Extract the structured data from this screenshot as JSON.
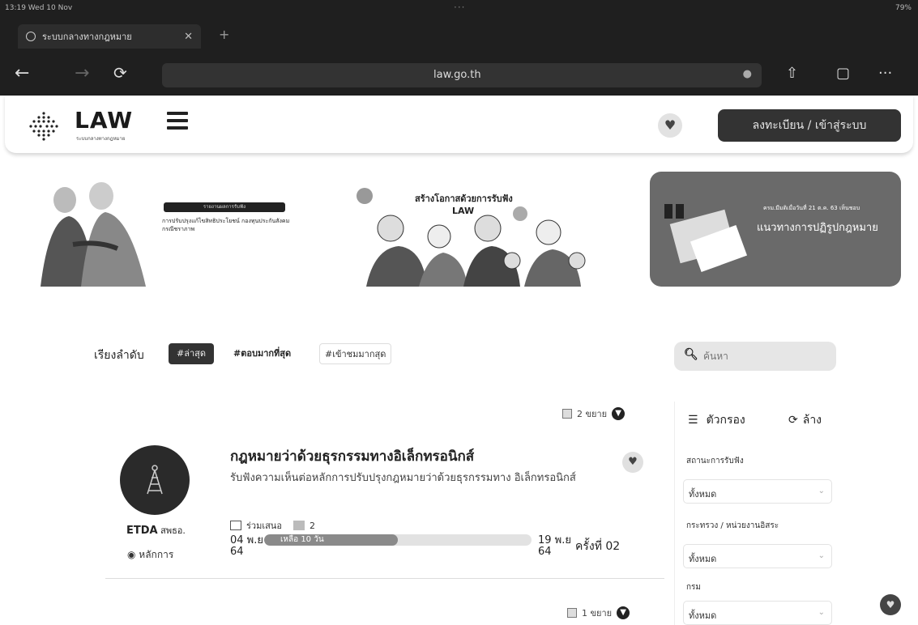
{
  "browser": {
    "status_time": "13:19  Wed 10 Nov",
    "battery": "79%",
    "tab_title": "ระบบกลางทางกฎหมาย",
    "url": "law.go.th"
  },
  "header": {
    "logo_text": "LAW",
    "logo_subtitle": "ระบบกลางทางกฎหมาย",
    "login_label": "ลงทะเบียน / เข้าสู่ระบบ"
  },
  "banners": [
    {
      "pill": "รายงานผลการรับฟัง",
      "lines": "การปรับปรุงแก้ไขสิทธิประโยชน์ กองทุนประกันสังคมกรณีชราภาพ"
    },
    {
      "title": "สร้างโอกาสด้วยการรับฟัง",
      "logo": "LAW"
    },
    {
      "line1": "ครม.มีมติเมื่อวันที่ 21 ต.ค. 63 เห็นชอบ",
      "line2": "แนวทางการปฏิรูปกฎหมาย"
    }
  ],
  "sort": {
    "label": "เรียงลำดับ",
    "options": [
      "#ล่าสุด",
      "#ตอบมากที่สุด",
      "#เข้าชมมากสุด"
    ]
  },
  "search": {
    "placeholder": "ค้นหา"
  },
  "expand_top": "2 ขยาย",
  "expand_bottom": "1 ขยาย",
  "card": {
    "title": "กฎหมายว่าด้วยธุรกรรมทางอิเล็กทรอนิกส์",
    "description": "รับฟังความเห็นต่อหลักการปรับปรุงกฎหมายว่าด้วยธุรกรรมทาง อิเล็กทรอนิกส์",
    "org": "ETDA",
    "org_short": "สพธอ.",
    "category": "หลักการ",
    "participants_label": "ร่วมเสนอ",
    "comment_count": "2",
    "start_day": "04 พ.ย",
    "start_year": "64",
    "end_day": "19 พ.ย",
    "end_year": "64",
    "remaining": "เหลือ 10 วัน",
    "progress": 0.5,
    "round": "ครั้งที่ 02"
  },
  "filters": {
    "title": "ตัวกรอง",
    "reset": "ล้าง",
    "groups": [
      {
        "label": "สถานะการรับฟัง",
        "value": "ทั้งหมด"
      },
      {
        "label": "กระทรวง / หน่วยงานอิสระ",
        "value": "ทั้งหมด"
      },
      {
        "label": "กรม",
        "value": "ทั้งหมด"
      }
    ]
  }
}
